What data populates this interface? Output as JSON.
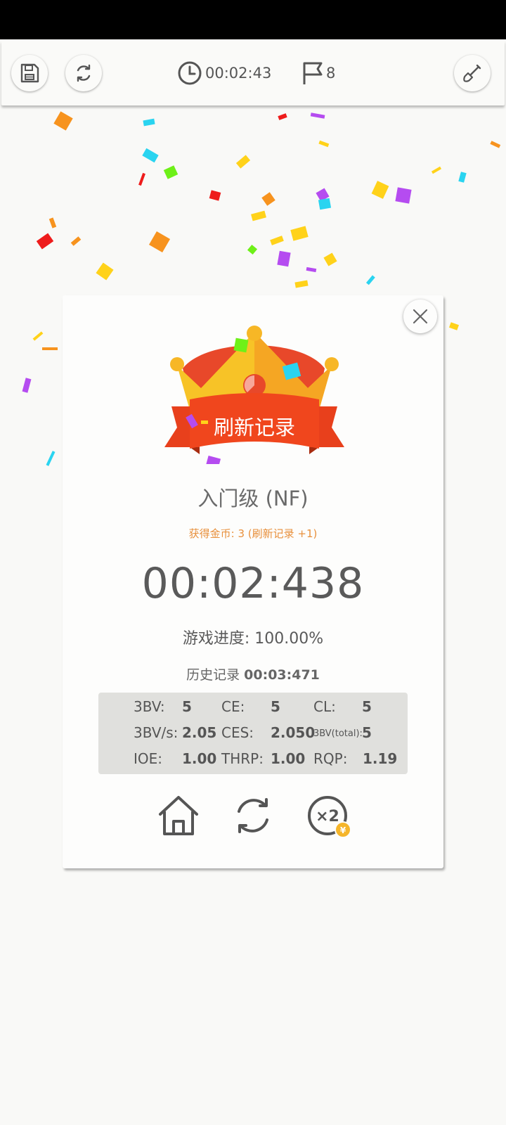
{
  "toolbar": {
    "timer": "00:02:43",
    "flags": "8",
    "save_icon": "save-icon",
    "restart_icon": "refresh-icon",
    "shovel_icon": "shovel-icon"
  },
  "result": {
    "banner": "刷新记录",
    "level": "入门级 (NF)",
    "coins": "获得金币: 3 (刷新记录 +1)",
    "time": "00:02:438",
    "progress": "游戏进度:  100.00%",
    "history_label": "历史记录",
    "history_value": "00:03:471"
  },
  "stats": [
    {
      "label": "3BV:",
      "value": "5"
    },
    {
      "label": "CE:",
      "value": "5"
    },
    {
      "label": "CL:",
      "value": "5"
    },
    {
      "label": "3BV/s:",
      "value": "2.05"
    },
    {
      "label": "CES:",
      "value": "2.050"
    },
    {
      "label": "3BV(total):",
      "value": "5"
    },
    {
      "label": "IOE:",
      "value": "1.00"
    },
    {
      "label": "THRP:",
      "value": "1.00"
    },
    {
      "label": "RQP:",
      "value": "1.19"
    }
  ],
  "actions": {
    "home_icon": "home-icon",
    "replay_icon": "refresh-icon",
    "double_label": "×2",
    "coin_symbol": "¥"
  },
  "colors": {
    "background": "#f9f9f7",
    "coin_text": "#e8903c",
    "ribbon": "#e8401c",
    "crown": "#f7b726",
    "stats_bg": "#e0e0dd"
  }
}
